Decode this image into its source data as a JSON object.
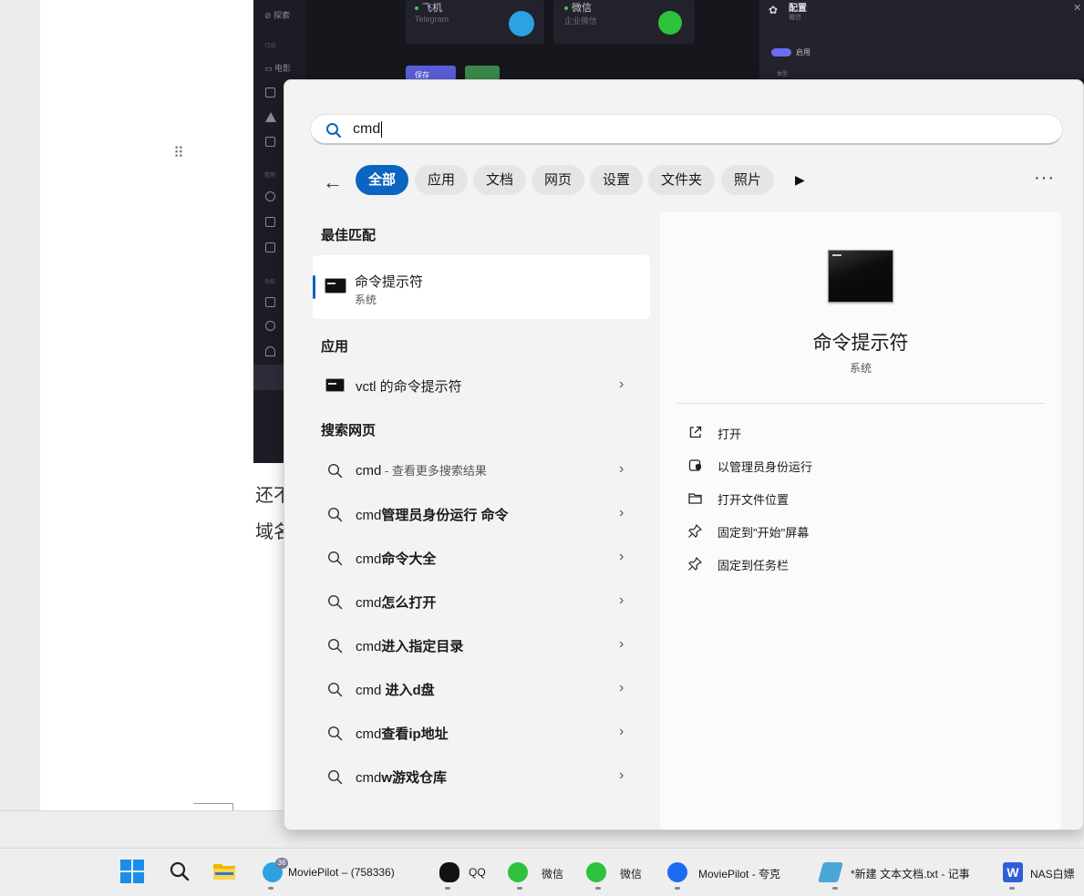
{
  "background": {
    "doc_lines": [
      "还不",
      "域名"
    ],
    "moviepilot": {
      "sidebar": {
        "explore": "探索",
        "subscribe_caption": "订阅",
        "movie": "电影",
        "caption2": "整理",
        "caption3": "系统"
      },
      "cards": [
        {
          "title": "飞机",
          "sub": "Telegram"
        },
        {
          "title": "微信",
          "sub": "企业微信"
        }
      ],
      "panel": {
        "title": "配置",
        "sub": "微信",
        "toggle_label": "启用",
        "field_label": "类型"
      },
      "save_label": "保存"
    }
  },
  "search": {
    "query": "cmd",
    "back_label": "←",
    "filters": [
      "全部",
      "应用",
      "文档",
      "网页",
      "设置",
      "文件夹",
      "照片"
    ],
    "active_filter": "全部",
    "more_label": "···",
    "play_label": "▶"
  },
  "results": {
    "best_match_heading": "最佳匹配",
    "best_match": {
      "title": "命令提示符",
      "subtitle": "系统"
    },
    "apps_heading": "应用",
    "apps": [
      {
        "label": "vctl 的命令提示符"
      }
    ],
    "web_heading": "搜索网页",
    "web": [
      {
        "prefix": "cmd",
        "rest": "",
        "hint": " - 查看更多搜索结果"
      },
      {
        "prefix": "cmd",
        "rest": "管理员身份运行 命令",
        "hint": ""
      },
      {
        "prefix": "cmd",
        "rest": "命令大全",
        "hint": ""
      },
      {
        "prefix": "cmd",
        "rest": "怎么打开",
        "hint": ""
      },
      {
        "prefix": "cmd",
        "rest": "进入指定目录",
        "hint": ""
      },
      {
        "prefix": "cmd ",
        "rest": "进入d盘",
        "hint": ""
      },
      {
        "prefix": "cmd",
        "rest": "查看ip地址",
        "hint": ""
      },
      {
        "prefix": "cmd",
        "rest": "w游戏仓库",
        "hint": ""
      }
    ],
    "chevron": "›"
  },
  "preview": {
    "title": "命令提示符",
    "subtitle": "系统",
    "actions": [
      {
        "label": "打开",
        "icon": "open-external-icon"
      },
      {
        "label": "以管理员身份运行",
        "icon": "shield-admin-icon"
      },
      {
        "label": "打开文件位置",
        "icon": "folder-open-icon"
      },
      {
        "label": "固定到\"开始\"屏幕",
        "icon": "pin-icon"
      },
      {
        "label": "固定到任务栏",
        "icon": "pin-icon"
      }
    ]
  },
  "taskbar": {
    "apps": [
      {
        "label": "MoviePilot – (758336)",
        "badge": "36",
        "icon": "telegram-icon",
        "color": "#2aa3e0"
      },
      {
        "label": "QQ",
        "icon": "qq-penguin-icon",
        "color": "#111111"
      },
      {
        "label": "微信",
        "icon": "wechat-icon",
        "color": "#2dc13c"
      },
      {
        "label": "微信",
        "icon": "wechat-icon",
        "color": "#2dc13c"
      },
      {
        "label": "MoviePilot - 夸克",
        "icon": "quark-browser-icon",
        "color": "#1d6cf0"
      },
      {
        "label": "*新建 文本文档.txt - 记事",
        "icon": "notepad-icon",
        "color": "#4aa6d6"
      },
      {
        "label": "NAS白嫖",
        "icon": "word-icon",
        "color": "#2f5ed6"
      }
    ]
  },
  "colors": {
    "accent": "#0b64c0",
    "flyout_bg": "#f3f3f3",
    "preview_bg": "#fbfbfb"
  }
}
